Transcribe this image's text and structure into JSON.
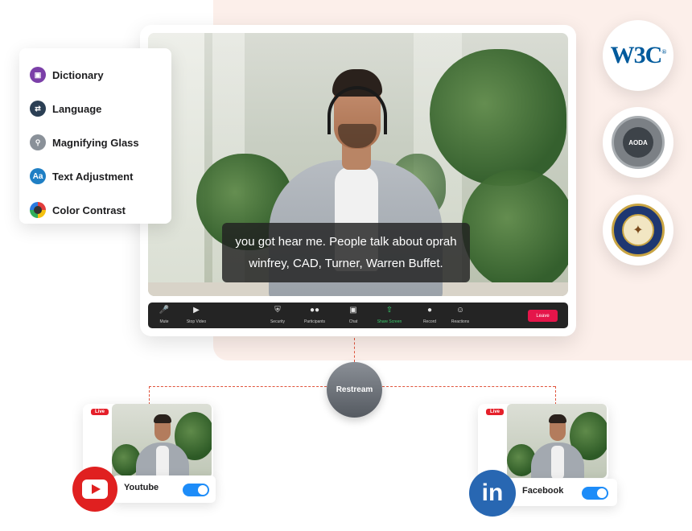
{
  "accessibility_menu": {
    "items": [
      {
        "label": "Dictionary",
        "icon": "book-icon",
        "color": "#7b3fa8"
      },
      {
        "label": "Language",
        "icon": "translate-icon",
        "color": "#2b3f54"
      },
      {
        "label": "Magnifying Glass",
        "icon": "magnifier-icon",
        "color": "#8a9199"
      },
      {
        "label": "Text Adjustment",
        "icon": "text-size-icon",
        "color": "#1f7fc4"
      },
      {
        "label": "Color Contrast",
        "icon": "contrast-icon",
        "color": "#3a3a3a"
      }
    ]
  },
  "meeting": {
    "caption_line1": "you got hear me. People talk about oprah",
    "caption_line2": "winfrey, CAD, Turner, Warren Buffet.",
    "toolbar": {
      "mute": "Mute",
      "stop_video": "Stop Video",
      "security": "Security",
      "participants": "Participants",
      "chat": "Chat",
      "share_screen": "Share Screen",
      "record": "Record",
      "reactions": "Reactions",
      "leave": "Leave"
    }
  },
  "badges": {
    "w3c": "W3C",
    "aoda": "AODA"
  },
  "restream": {
    "label": "Restream"
  },
  "destinations": {
    "youtube": {
      "name": "Youtube",
      "live": "Live",
      "enabled": true,
      "color": "#e02020"
    },
    "facebook": {
      "name": "Facebook",
      "live": "Live",
      "enabled": true,
      "color": "#2867b2"
    }
  },
  "colors": {
    "accent_blue": "#1d8cf8",
    "leave_red": "#e5154a",
    "connector": "#e0543c",
    "panel_bg": "#fcefea"
  }
}
